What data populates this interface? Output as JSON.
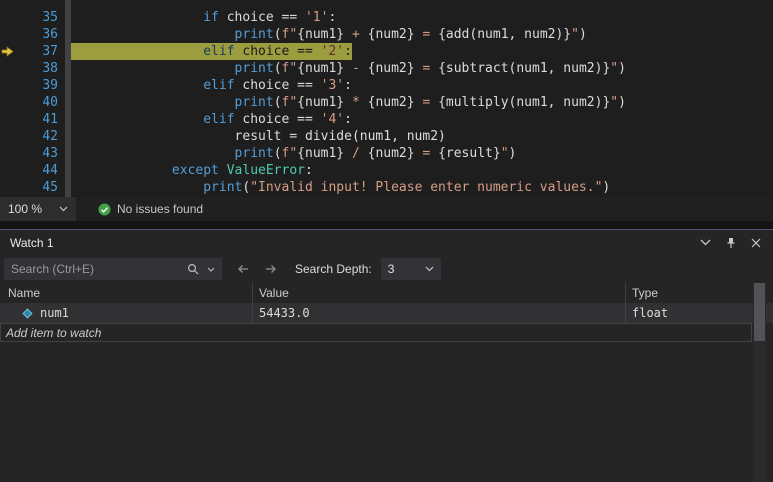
{
  "editor": {
    "syntax_colors": {
      "kw": "#569CD6",
      "fn": "#569CD6",
      "plain": "#DCDCDC",
      "str": "#D69D85",
      "cls": "#4EC9B0",
      "kwH": "#1A3A5C",
      "plainH": "#1A1A1A",
      "strH": "#5E2C2C"
    },
    "lines": [
      {
        "num": "35",
        "tokens": [
          [
            "                ",
            "plain"
          ],
          [
            "if",
            "kw"
          ],
          [
            " choice == ",
            "plain"
          ],
          [
            "'1'",
            "str"
          ],
          [
            ":",
            "plain"
          ]
        ]
      },
      {
        "num": "36",
        "tokens": [
          [
            "                    ",
            "plain"
          ],
          [
            "print",
            "fn"
          ],
          [
            "(",
            "plain"
          ],
          [
            "f\"",
            "str"
          ],
          [
            "{num1}",
            "plain"
          ],
          [
            " + ",
            "str"
          ],
          [
            "{num2}",
            "plain"
          ],
          [
            " = ",
            "str"
          ],
          [
            "{add(num1, num2)}",
            "plain"
          ],
          [
            "\"",
            "str"
          ],
          [
            ")",
            "plain"
          ]
        ]
      },
      {
        "num": "37",
        "current": true,
        "tokens": [
          [
            "                ",
            "plainH"
          ],
          [
            "elif",
            "kwH"
          ],
          [
            " choice == ",
            "plainH"
          ],
          [
            "'2'",
            "strH"
          ],
          [
            ":",
            "plainH"
          ]
        ]
      },
      {
        "num": "38",
        "tokens": [
          [
            "                    ",
            "plain"
          ],
          [
            "print",
            "fn"
          ],
          [
            "(",
            "plain"
          ],
          [
            "f\"",
            "str"
          ],
          [
            "{num1}",
            "plain"
          ],
          [
            " - ",
            "str"
          ],
          [
            "{num2}",
            "plain"
          ],
          [
            " = ",
            "str"
          ],
          [
            "{subtract(num1, num2)}",
            "plain"
          ],
          [
            "\"",
            "str"
          ],
          [
            ")",
            "plain"
          ]
        ]
      },
      {
        "num": "39",
        "tokens": [
          [
            "                ",
            "plain"
          ],
          [
            "elif",
            "kw"
          ],
          [
            " choice == ",
            "plain"
          ],
          [
            "'3'",
            "str"
          ],
          [
            ":",
            "plain"
          ]
        ]
      },
      {
        "num": "40",
        "tokens": [
          [
            "                    ",
            "plain"
          ],
          [
            "print",
            "fn"
          ],
          [
            "(",
            "plain"
          ],
          [
            "f\"",
            "str"
          ],
          [
            "{num1}",
            "plain"
          ],
          [
            " * ",
            "str"
          ],
          [
            "{num2}",
            "plain"
          ],
          [
            " = ",
            "str"
          ],
          [
            "{multiply(num1, num2)}",
            "plain"
          ],
          [
            "\"",
            "str"
          ],
          [
            ")",
            "plain"
          ]
        ]
      },
      {
        "num": "41",
        "tokens": [
          [
            "                ",
            "plain"
          ],
          [
            "elif",
            "kw"
          ],
          [
            " choice == ",
            "plain"
          ],
          [
            "'4'",
            "str"
          ],
          [
            ":",
            "plain"
          ]
        ]
      },
      {
        "num": "42",
        "tokens": [
          [
            "                    ",
            "plain"
          ],
          [
            "result = divide(num1, num2)",
            "plain"
          ]
        ]
      },
      {
        "num": "43",
        "tokens": [
          [
            "                    ",
            "plain"
          ],
          [
            "print",
            "fn"
          ],
          [
            "(",
            "plain"
          ],
          [
            "f\"",
            "str"
          ],
          [
            "{num1}",
            "plain"
          ],
          [
            " / ",
            "str"
          ],
          [
            "{num2}",
            "plain"
          ],
          [
            " = ",
            "str"
          ],
          [
            "{result}",
            "plain"
          ],
          [
            "\"",
            "str"
          ],
          [
            ")",
            "plain"
          ]
        ]
      },
      {
        "num": "44",
        "tokens": [
          [
            "            ",
            "plain"
          ],
          [
            "except",
            "kw"
          ],
          [
            " ",
            "plain"
          ],
          [
            "ValueError",
            "cls"
          ],
          [
            ":",
            "plain"
          ]
        ]
      },
      {
        "num": "45",
        "tokens": [
          [
            "                ",
            "plain"
          ],
          [
            "print",
            "fn"
          ],
          [
            "(",
            "plain"
          ],
          [
            "\"Invalid input! Please enter numeric values.\"",
            "str"
          ],
          [
            ")",
            "plain"
          ]
        ]
      }
    ]
  },
  "statusbar": {
    "zoom_value": "100 %",
    "issues_text": "No issues found"
  },
  "watch": {
    "title": "Watch 1",
    "search_placeholder": "Search (Ctrl+E)",
    "search_depth_label": "Search Depth:",
    "search_depth_value": "3",
    "columns": [
      "Name",
      "Value",
      "Type"
    ],
    "rows": [
      {
        "name": "num1",
        "value": "54433.0",
        "type": "float"
      }
    ],
    "add_row_label": "Add item to watch"
  },
  "icons": {
    "current_statement": "yellow-arrow-right",
    "no_issues": "green-check-circle",
    "search": "magnifier",
    "search_options": "chevron-down",
    "nav_back": "arrow-left",
    "nav_forward": "arrow-right",
    "window_position": "chevron-down",
    "pin": "pushpin",
    "close": "x",
    "variable": "teal-diamond"
  },
  "colors": {
    "accent_highlight": "#9C9D3F",
    "panel_bg": "#252526",
    "editor_bg": "#1E1E1E",
    "status_green": "#43A047"
  }
}
